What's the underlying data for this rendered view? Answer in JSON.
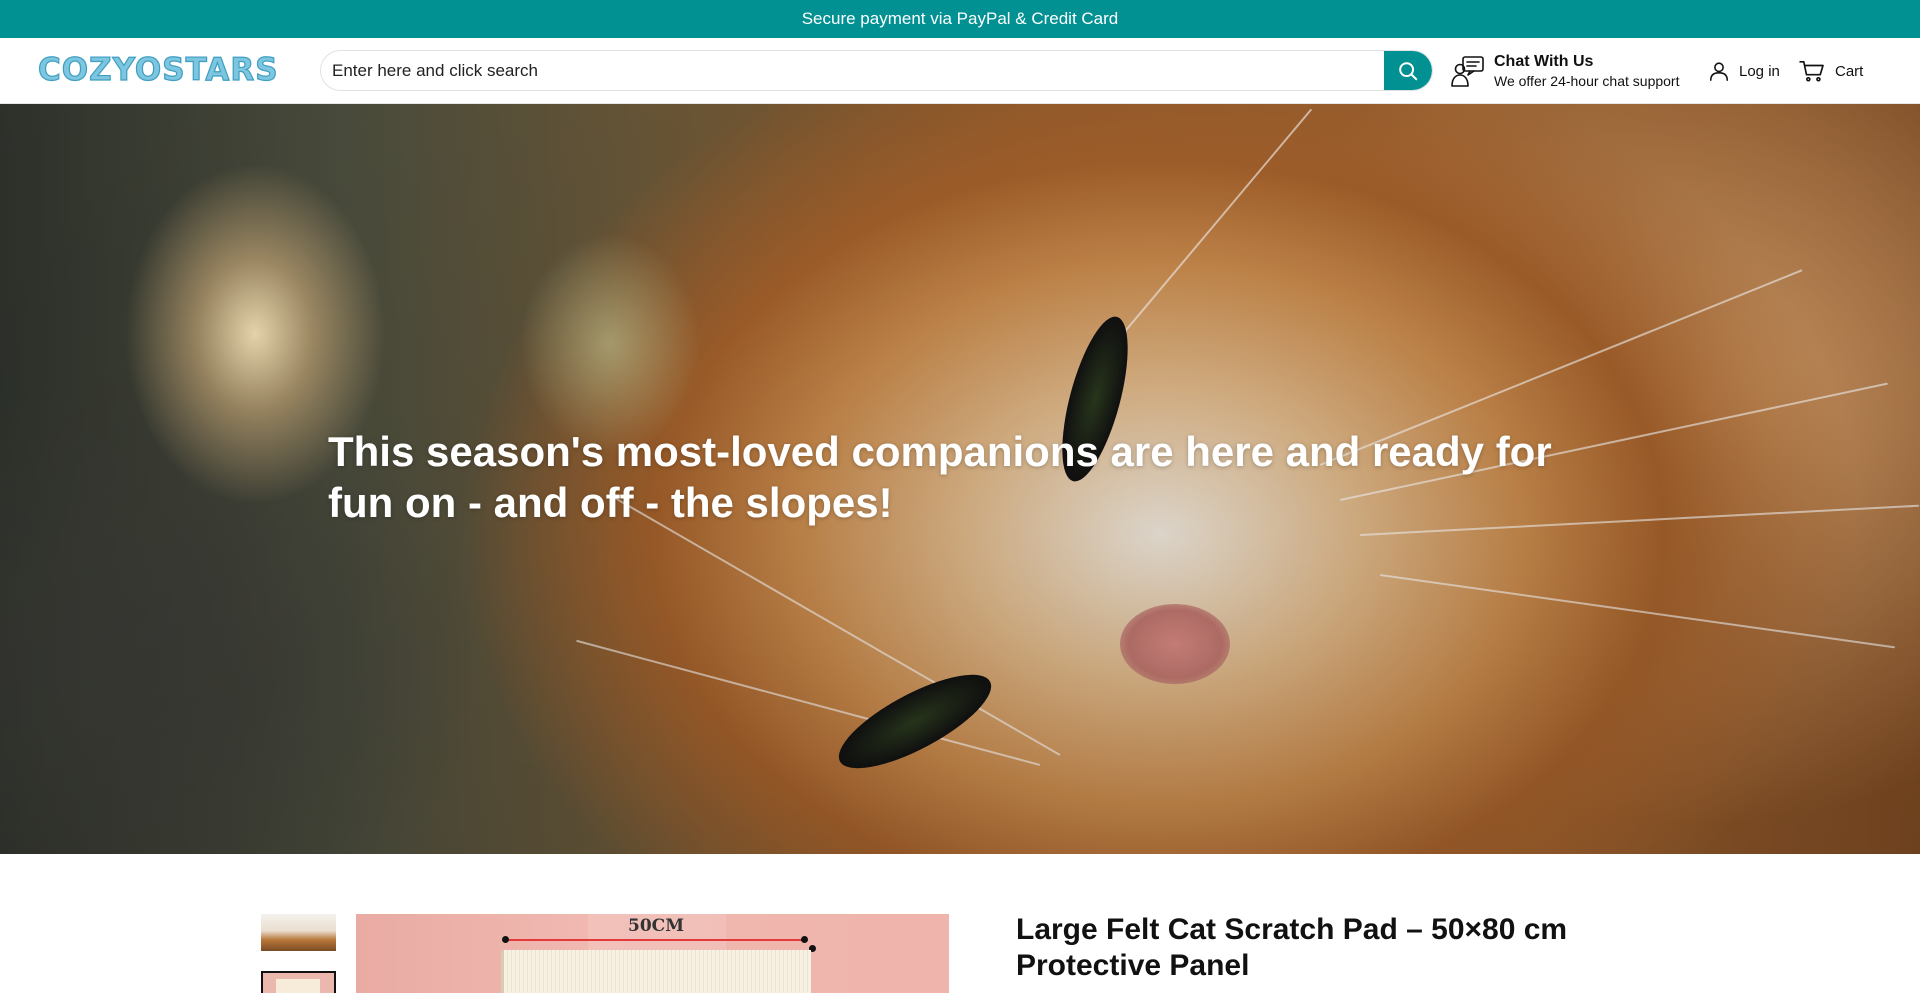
{
  "announcement": {
    "text": "Secure payment via PayPal & Credit Card"
  },
  "header": {
    "logo_text": "COZYOSTARS",
    "search": {
      "placeholder": "Enter here and click search",
      "value": ""
    },
    "chat": {
      "title": "Chat With Us",
      "subtitle": "We offer 24-hour chat support"
    },
    "login_label": "Log in",
    "cart_label": "Cart"
  },
  "hero": {
    "title": "This season's most-loved companions are here and ready for fun on - and off - the slopes!"
  },
  "product": {
    "title": "Large Felt Cat Scratch Pad – 50×80 cm Protective Panel",
    "main_image_label": "50CM"
  },
  "colors": {
    "accent": "#019193",
    "logo": "#7cc6e0",
    "text": "#111111",
    "background": "#ffffff"
  },
  "icons": [
    "search-icon",
    "chat-support-icon",
    "user-icon",
    "cart-icon"
  ]
}
